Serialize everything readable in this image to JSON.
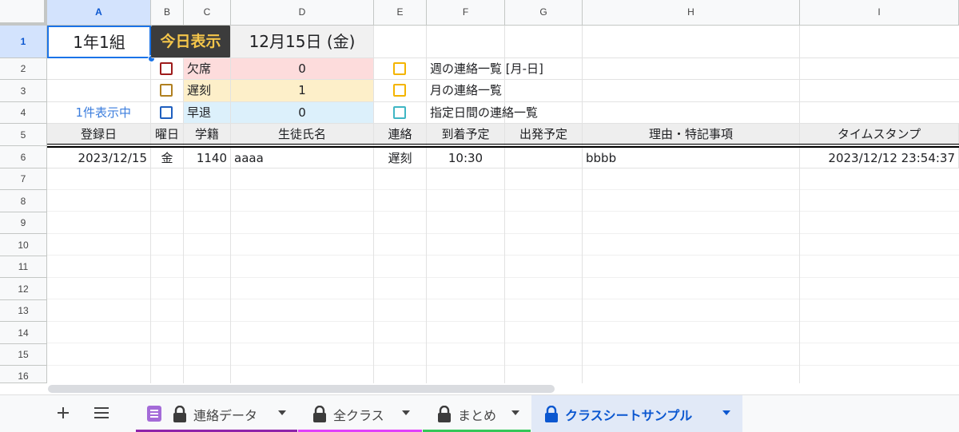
{
  "columns": [
    "A",
    "B",
    "C",
    "D",
    "E",
    "F",
    "G",
    "H",
    "I"
  ],
  "rows": [
    "1",
    "2",
    "3",
    "4",
    "5",
    "6",
    "7",
    "8",
    "9",
    "10",
    "11",
    "12",
    "13",
    "14",
    "15",
    "16"
  ],
  "header": {
    "class_name": "1年1組",
    "today_button": "今日表示",
    "date": "12月15日 (金)"
  },
  "stats": [
    {
      "label": "欠席",
      "value": "0",
      "color": "#9e1b1b",
      "bg": "#fddcdc"
    },
    {
      "label": "遅刻",
      "value": "1",
      "color": "#b08020",
      "bg": "#fdefc9"
    },
    {
      "label": "早退",
      "value": "0",
      "color": "#1f5fbf",
      "bg": "#dcf0fb"
    }
  ],
  "count_label": "1件表示中",
  "options": [
    {
      "label": "週の連絡一覧 [月-日]",
      "color": "#f4b400"
    },
    {
      "label": "月の連絡一覧",
      "color": "#f4b400"
    },
    {
      "label": "指定日間の連絡一覧",
      "color": "#3fb6c4"
    }
  ],
  "table": {
    "headers": [
      "登録日",
      "曜日",
      "学籍",
      "生徒氏名",
      "連絡",
      "到着予定",
      "出発予定",
      "理由・特記事項",
      "タイムスタンプ"
    ],
    "rows": [
      [
        "2023/12/15",
        "金",
        "1140",
        "aaaa",
        "遅刻",
        "10:30",
        "",
        "bbbb",
        "2023/12/12 23:54:37"
      ]
    ]
  },
  "sheet_tabs": [
    {
      "label": "連絡データ",
      "stripe": "#8e24aa",
      "icon": "form-icon"
    },
    {
      "label": "全クラス",
      "stripe": "#e040fb",
      "icon": "lock-icon"
    },
    {
      "label": "まとめ",
      "stripe": "#34c759",
      "icon": "lock-icon"
    },
    {
      "label": "クラスシートサンプル",
      "stripe": "",
      "icon": "lock-icon",
      "active": true
    }
  ],
  "colors": {
    "accent": "#0b57d0",
    "today_button_bg": "#3c3c3c",
    "today_button_fg": "#f5c64a"
  }
}
